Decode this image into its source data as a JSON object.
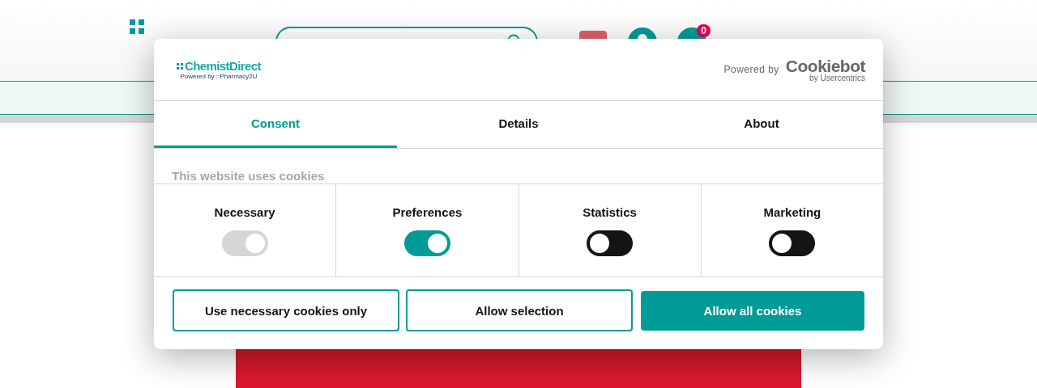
{
  "site_header": {
    "cart_count": "0"
  },
  "dialog": {
    "brand_logo": "ChemistDirect",
    "brand_sub": "Powered by ::Pharmacy2U",
    "powered_by": "Powered by",
    "provider_logo": "Cookiebot",
    "provider_sub": "by Usercentrics",
    "tabs": [
      {
        "label": "Consent",
        "selected": true
      },
      {
        "label": "Details",
        "selected": false
      },
      {
        "label": "About",
        "selected": false
      }
    ],
    "heading": "This website uses cookies",
    "categories": [
      {
        "label": "Necessary",
        "checked": true,
        "disabled": true
      },
      {
        "label": "Preferences",
        "checked": true,
        "disabled": false
      },
      {
        "label": "Statistics",
        "checked": false,
        "disabled": false
      },
      {
        "label": "Marketing",
        "checked": false,
        "disabled": false
      }
    ],
    "buttons": [
      {
        "label": "Use necessary cookies only",
        "kind": "outline"
      },
      {
        "label": "Allow selection",
        "kind": "outline"
      },
      {
        "label": "Allow all cookies",
        "kind": "primary"
      }
    ]
  }
}
